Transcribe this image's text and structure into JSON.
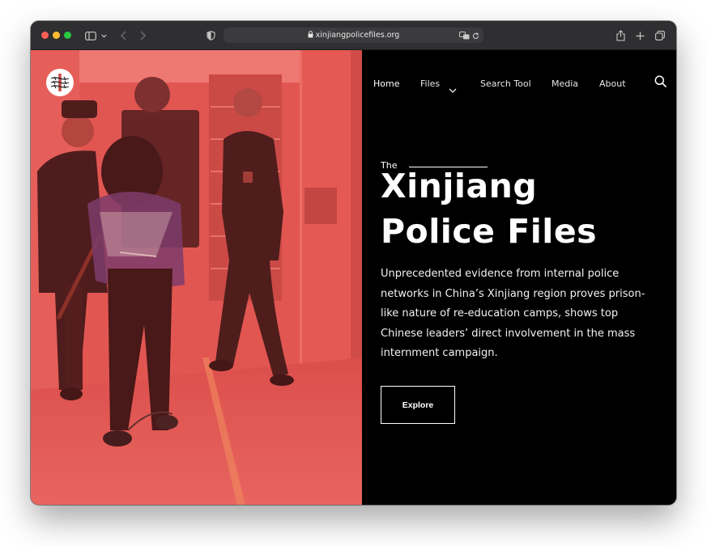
{
  "browser": {
    "url": "xinjiangpolicefiles.org",
    "icons": [
      "sidebar-icon",
      "chevron-down-icon",
      "back-icon",
      "forward-icon",
      "shield-icon",
      "lock-icon",
      "translate-icon",
      "reload-icon",
      "share-icon",
      "new-tab-icon",
      "tabs-overview-icon"
    ]
  },
  "nav": {
    "items": [
      {
        "label": "Home",
        "active": true
      },
      {
        "label": "Files",
        "has_dropdown": true
      },
      {
        "label": "Search Tool"
      },
      {
        "label": "Media"
      },
      {
        "label": "About"
      }
    ],
    "search_icon": "search-icon"
  },
  "hero": {
    "eyebrow": "The",
    "title_line1": "Xinjiang",
    "title_line2": "Police Files",
    "lede": "Unprecedented evidence from internal police networks in China’s Xinjiang region proves prison-like nature of re-education camps, shows top Chinese leaders’ direct involvement in the mass internment campaign.",
    "cta": "Explore"
  },
  "colors": {
    "page_bg": "#000000",
    "image_tint": "#e15a57",
    "text": "#ffffff",
    "toolbar": "#2f2f31"
  }
}
